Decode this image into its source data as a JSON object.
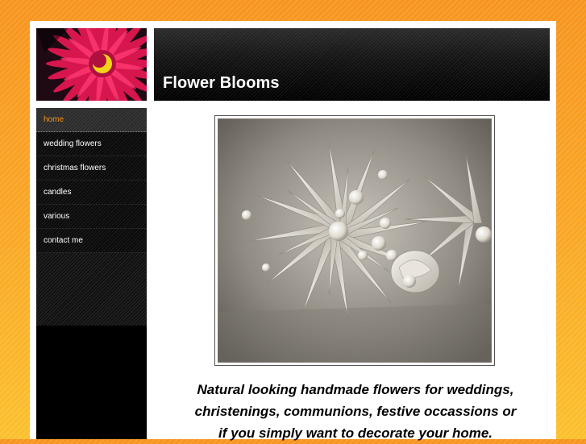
{
  "site": {
    "title": "Flower Blooms"
  },
  "nav": {
    "items": [
      {
        "label": "home",
        "active": true
      },
      {
        "label": "wedding flowers",
        "active": false
      },
      {
        "label": "christmas flowers",
        "active": false
      },
      {
        "label": "candles",
        "active": false
      },
      {
        "label": "various",
        "active": false
      },
      {
        "label": "contact me",
        "active": false
      }
    ]
  },
  "main": {
    "tagline": [
      "Natural looking handmade flowers for weddings,",
      "christenings, communions, festive occassions or",
      "if you simply want to decorate your home."
    ]
  },
  "colors": {
    "accent": "#f7941d",
    "background_top": "#f7941d",
    "background_bottom": "#fbc02d",
    "header": "#000000",
    "nav_text": "#ffffff"
  },
  "icons": {
    "logo": "red-flower-logo"
  }
}
